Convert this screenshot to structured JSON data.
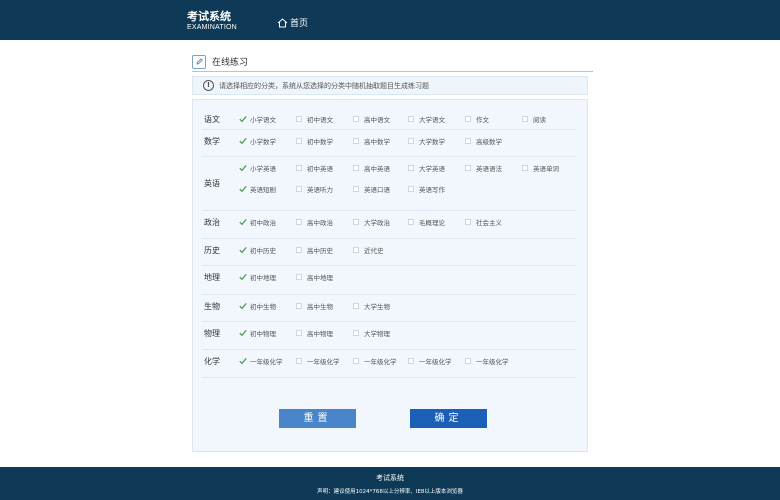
{
  "header": {
    "brand_title": "考试系统",
    "brand_subtitle": "EXAMINATION",
    "nav_home": "首页",
    "background_color": "#0e3a57"
  },
  "section": {
    "title": "在线练习",
    "icon": "pencil-icon"
  },
  "notice": {
    "icon": "exclamation-circle-icon",
    "text": "请选择相应的分类，系统从您选择的分类中随机抽取题目生成练习题"
  },
  "categories": [
    {
      "name": "语文",
      "options": [
        {
          "label": "小学语文",
          "checked": true
        },
        {
          "label": "初中语文",
          "checked": false
        },
        {
          "label": "高中语文",
          "checked": false
        },
        {
          "label": "大学语文",
          "checked": false
        },
        {
          "label": "作文",
          "checked": false
        },
        {
          "label": "阅读",
          "checked": false
        }
      ]
    },
    {
      "name": "数学",
      "options": [
        {
          "label": "小学数学",
          "checked": true
        },
        {
          "label": "初中数学",
          "checked": false
        },
        {
          "label": "高中数学",
          "checked": false
        },
        {
          "label": "大学数学",
          "checked": false
        },
        {
          "label": "高级数学",
          "checked": false
        }
      ]
    },
    {
      "name": "英语",
      "options": [
        {
          "label": "小学英语",
          "checked": true
        },
        {
          "label": "初中英语",
          "checked": false
        },
        {
          "label": "高中英语",
          "checked": false
        },
        {
          "label": "大学英语",
          "checked": false
        },
        {
          "label": "英语语法",
          "checked": false
        },
        {
          "label": "英语单词",
          "checked": false
        },
        {
          "label": "英语短剧",
          "checked": true
        },
        {
          "label": "英语听力",
          "checked": false
        },
        {
          "label": "英语口语",
          "checked": false
        },
        {
          "label": "英语写作",
          "checked": false
        }
      ]
    },
    {
      "name": "政治",
      "options": [
        {
          "label": "初中政治",
          "checked": true
        },
        {
          "label": "高中政治",
          "checked": false
        },
        {
          "label": "大学政治",
          "checked": false
        },
        {
          "label": "毛概理论",
          "checked": false
        },
        {
          "label": "社会主义",
          "checked": false
        }
      ]
    },
    {
      "name": "历史",
      "options": [
        {
          "label": "初中历史",
          "checked": true
        },
        {
          "label": "高中历史",
          "checked": false
        },
        {
          "label": "近代史",
          "checked": false
        }
      ]
    },
    {
      "name": "地理",
      "options": [
        {
          "label": "初中地理",
          "checked": true
        },
        {
          "label": "高中地理",
          "checked": false
        }
      ]
    },
    {
      "name": "生物",
      "options": [
        {
          "label": "初中生物",
          "checked": true
        },
        {
          "label": "高中生物",
          "checked": false
        },
        {
          "label": "大学生物",
          "checked": false
        }
      ]
    },
    {
      "name": "物理",
      "options": [
        {
          "label": "初中物理",
          "checked": true
        },
        {
          "label": "高中物理",
          "checked": false
        },
        {
          "label": "大学物理",
          "checked": false
        }
      ]
    },
    {
      "name": "化学",
      "options": [
        {
          "label": "一年级化学",
          "checked": true
        },
        {
          "label": "一年级化学",
          "checked": false
        },
        {
          "label": "一年级化学",
          "checked": false
        },
        {
          "label": "一年级化学",
          "checked": false
        },
        {
          "label": "一年级化学",
          "checked": false
        }
      ]
    }
  ],
  "buttons": {
    "reset": "重置",
    "confirm": "确定"
  },
  "footer": {
    "title": "考试系统",
    "note": "声明：建议使用1024*768以上分辨率、IE8以上版本浏览器"
  }
}
